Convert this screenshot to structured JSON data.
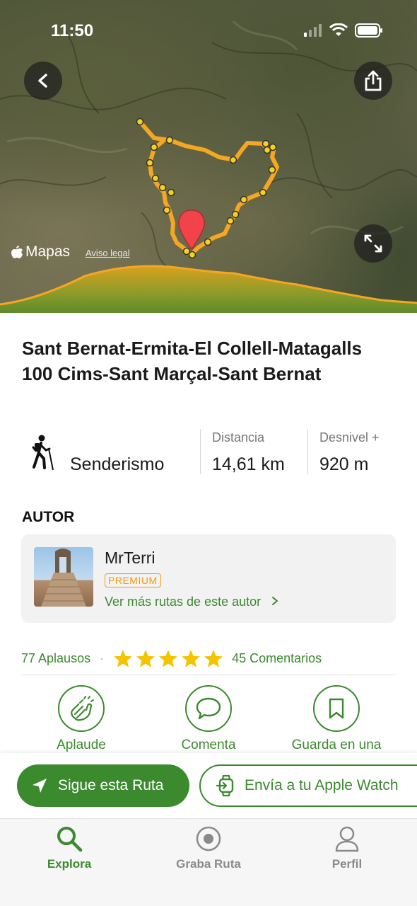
{
  "status_bar": {
    "time": "11:50"
  },
  "map": {
    "brand": "Mapas",
    "legal_link": "Aviso legal"
  },
  "route": {
    "title": "Sant Bernat-Ermita-El Collell-Matagalls 100 Cims-Sant Marçal-Sant Bernat",
    "activity": "Senderismo",
    "distance_label": "Distancia",
    "distance_value": "14,61 km",
    "elevation_label": "Desnivel +",
    "elevation_value": "920 m"
  },
  "author": {
    "section_title": "AUTOR",
    "name": "MrTerri",
    "badge": "PREMIUM",
    "more_routes": "Ver más rutas de este autor"
  },
  "social": {
    "applause": "77 Aplausos",
    "separator": "·",
    "rating": 5,
    "comments": "45 Comentarios"
  },
  "actions": {
    "applaud": "Aplaude",
    "comment": "Comenta",
    "save": "Guarda en una"
  },
  "cta": {
    "follow": "Sigue esta Ruta",
    "watch": "Envía a tu Apple Watch"
  },
  "tabbar": {
    "explore": "Explora",
    "record": "Graba Ruta",
    "profile": "Perfil"
  },
  "colors": {
    "accent": "#3b8a2e",
    "route": "#f5a623",
    "premium": "#f39c12",
    "star": "#f5c400"
  },
  "icons": {
    "back": "chevron-left-icon",
    "share": "share-icon",
    "expand": "expand-icon",
    "hiker": "hiker-icon",
    "pin": "map-pin-icon"
  }
}
